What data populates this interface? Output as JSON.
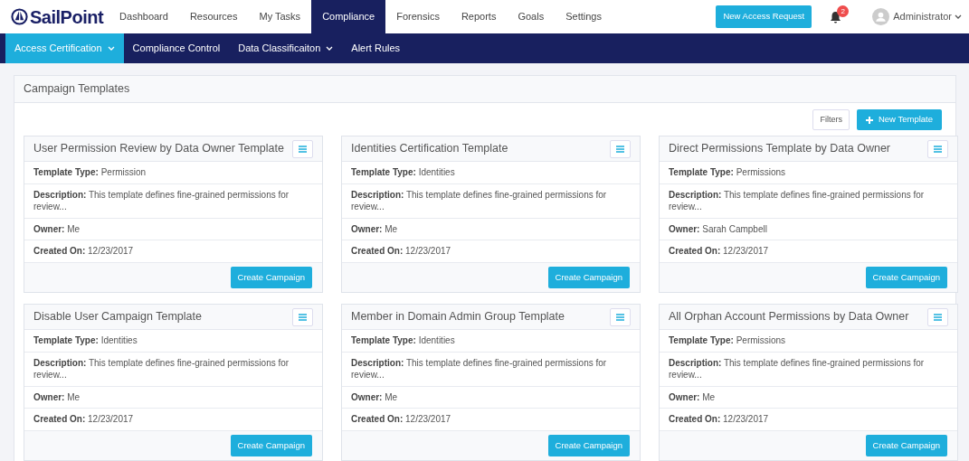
{
  "brand": {
    "name": "SailPoint"
  },
  "main_nav": [
    {
      "label": "Dashboard",
      "selected": false
    },
    {
      "label": "Resources",
      "selected": false
    },
    {
      "label": "My Tasks",
      "selected": false
    },
    {
      "label": "Compliance",
      "selected": true
    },
    {
      "label": "Forensics",
      "selected": false
    },
    {
      "label": "Reports",
      "selected": false
    },
    {
      "label": "Goals",
      "selected": false
    },
    {
      "label": "Settings",
      "selected": false
    }
  ],
  "header_actions": {
    "new_request": "New Access Request",
    "notifications": "2",
    "user": "Administrator"
  },
  "sub_nav": [
    {
      "label": "Access Certification",
      "selected": true,
      "dropdown": true
    },
    {
      "label": "Compliance Control",
      "selected": false,
      "dropdown": false
    },
    {
      "label": "Data Classificaiton",
      "selected": false,
      "dropdown": true
    },
    {
      "label": "Alert Rules",
      "selected": false,
      "dropdown": false
    }
  ],
  "panel": {
    "title": "Campaign Templates",
    "filters": "Filters",
    "new_template": "New Template"
  },
  "templates": [
    {
      "title": "User Permission Review by Data Owner Template",
      "fields": [
        "**Template Type:** Permission",
        "**Description:** This template defines fine-grained permissions for review...",
        "**Owner:** Me",
        "**Created On:** 12/23/2017"
      ],
      "action": "Create Campaign"
    },
    {
      "title": "Identities Certification Template",
      "fields": [
        "**Template Type:** Identities",
        "**Description:** This template defines fine-grained permissions for review...",
        "**Owner:** Me",
        "**Created On:** 12/23/2017"
      ],
      "action": "Create Campaign"
    },
    {
      "title": "Direct Permissions Template by Data Owner",
      "fields": [
        "**Template Type:** Permissions",
        "**Description:** This template defines fine-grained permissions for review...",
        "**Owner:** Sarah Campbell",
        "**Created On:** 12/23/2017"
      ],
      "action": "Create Campaign"
    },
    {
      "title": "Disable User Campaign Template",
      "fields": [
        "**Template Type:** Identities",
        "**Description:** This template defines fine-grained permissions for review...",
        "**Owner:** Me",
        "**Created On:** 12/23/2017"
      ],
      "action": "Create Campaign"
    },
    {
      "title": "Member in Domain Admin Group Template",
      "fields": [
        "**Template Type:** Identities",
        "**Description:** This template defines fine-grained permissions for review...",
        "**Owner:** Me",
        "**Created On:** 12/23/2017"
      ],
      "action": "Create Campaign"
    },
    {
      "title": "All Orphan Account Permissions by Data Owner",
      "fields": [
        "**Template Type:** Permissions",
        "**Description:** This template defines fine-grained permissions for review...",
        "**Owner:** Me",
        "**Created On:** 12/23/2017"
      ],
      "action": "Create Campaign"
    }
  ]
}
